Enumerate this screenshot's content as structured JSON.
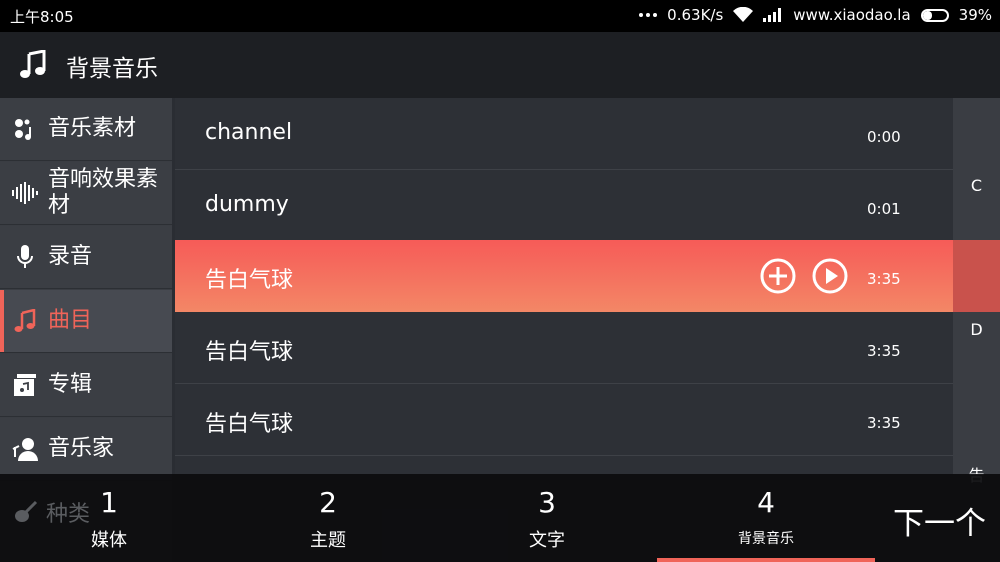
{
  "status": {
    "time": "上午8:05",
    "speed": "0.63K/s",
    "site": "www.xiaodao.la",
    "battery": "39%"
  },
  "app": {
    "title": "背景音乐"
  },
  "sidebar": {
    "items": [
      {
        "label": "音乐素材",
        "icon": "music-material-icon"
      },
      {
        "label": "音响效果素材",
        "icon": "sound-wave-icon"
      },
      {
        "label": "录音",
        "icon": "microphone-icon"
      },
      {
        "label": "曲目",
        "icon": "music-note-icon",
        "active": true
      },
      {
        "label": "专辑",
        "icon": "album-icon"
      },
      {
        "label": "音乐家",
        "icon": "artist-icon"
      }
    ],
    "partial_label": "种类"
  },
  "tracks": [
    {
      "name": "channel",
      "duration": "0:00"
    },
    {
      "name": "dummy",
      "duration": "0:01"
    },
    {
      "name": "告白气球",
      "duration": "3:35",
      "selected": true
    },
    {
      "name": "告白气球",
      "duration": "3:35"
    },
    {
      "name": "告白气球",
      "duration": "3:35"
    }
  ],
  "index_letters": [
    "C",
    "D",
    "告"
  ],
  "steps": [
    {
      "num": "1",
      "label": "媒体"
    },
    {
      "num": "2",
      "label": "主题"
    },
    {
      "num": "3",
      "label": "文字"
    },
    {
      "num": "4",
      "label": "背景音乐",
      "active": true
    }
  ],
  "next_label": "下一个",
  "colors": {
    "accent": "#f06459",
    "selected_row_top": "#f65b58",
    "selected_row_bottom": "#f38766"
  }
}
